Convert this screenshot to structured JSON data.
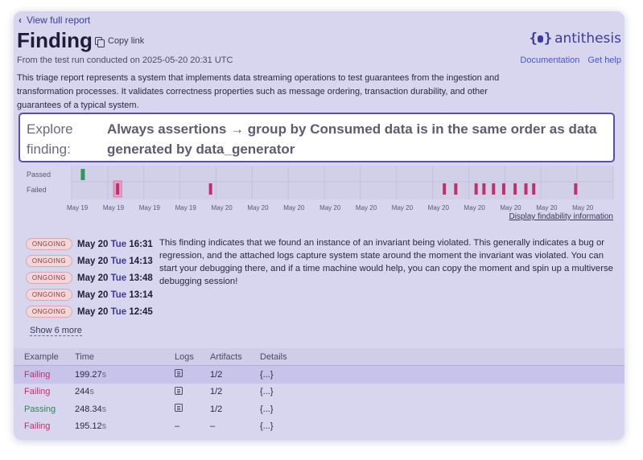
{
  "header": {
    "back_label": "View full report",
    "title": "Finding",
    "copy_label": "Copy link",
    "subtitle": "From the test run conducted on 2025-05-20 20:31 UTC",
    "brand": "antithesis",
    "links": [
      "Documentation",
      "Get help"
    ]
  },
  "description": "This triage report represents a system that implements data streaming operations to test guarantees from the ingestion and transformation processes. It validates correctness properties such as message ordering, transaction durability, and other guarantees of a typical system.",
  "explore": {
    "label": "Explore finding:",
    "text": "Always assertions → group by Consumed data is in the same order as data generated by data_generator"
  },
  "chart_data": {
    "type": "scatter",
    "rows": [
      "Passed",
      "Failed"
    ],
    "x_tick_labels": [
      "May 19",
      "May 19",
      "May 19",
      "May 19",
      "May 20",
      "May 20",
      "May 20",
      "May 20",
      "May 20",
      "May 20",
      "May 20",
      "May 20",
      "May 20",
      "May 20",
      "May 20"
    ],
    "passed_positions": [
      0.11
    ],
    "failed_positions": [
      0.168,
      0.323,
      0.713,
      0.732,
      0.766,
      0.779,
      0.795,
      0.812,
      0.831,
      0.849,
      0.862,
      0.932
    ],
    "highlighted_failed_index": 0,
    "colors": {
      "passed": "#2e9a5a",
      "failed": "#c0306e",
      "highlight": "#e3a3c3"
    }
  },
  "findability_label": "Display findability information",
  "ongoing": [
    {
      "badge": "ONGOING",
      "date": "May 20",
      "dow": "Tue",
      "time": "16:31"
    },
    {
      "badge": "ONGOING",
      "date": "May 20",
      "dow": "Tue",
      "time": "14:13"
    },
    {
      "badge": "ONGOING",
      "date": "May 20",
      "dow": "Tue",
      "time": "13:48"
    },
    {
      "badge": "ONGOING",
      "date": "May 20",
      "dow": "Tue",
      "time": "13:14"
    },
    {
      "badge": "ONGOING",
      "date": "May 20",
      "dow": "Tue",
      "time": "12:45"
    }
  ],
  "show_more": "Show 6 more",
  "finding_text": "This finding indicates that we found an instance of an invariant being violated. This generally indicates a bug or regression, and the attached logs capture system state around the moment the invariant was violated. You can start your debugging there, and if a time machine would help, you can copy the moment and spin up a multiverse debugging session!",
  "table": {
    "headers": [
      "Example",
      "Time",
      "Logs",
      "Artifacts",
      "Details"
    ],
    "rows": [
      {
        "example": "Failing",
        "time": "199.27",
        "unit": "s",
        "logs": true,
        "artifacts": "1/2",
        "details": "{...}"
      },
      {
        "example": "Failing",
        "time": "244",
        "unit": "s",
        "logs": true,
        "artifacts": "1/2",
        "details": "{...}"
      },
      {
        "example": "Passing",
        "time": "248.34",
        "unit": "s",
        "logs": true,
        "artifacts": "1/2",
        "details": "{...}"
      },
      {
        "example": "Failing",
        "time": "195.12",
        "unit": "s",
        "logs": false,
        "logs_text": "–",
        "artifacts": "–",
        "details": "{...}"
      }
    ]
  }
}
